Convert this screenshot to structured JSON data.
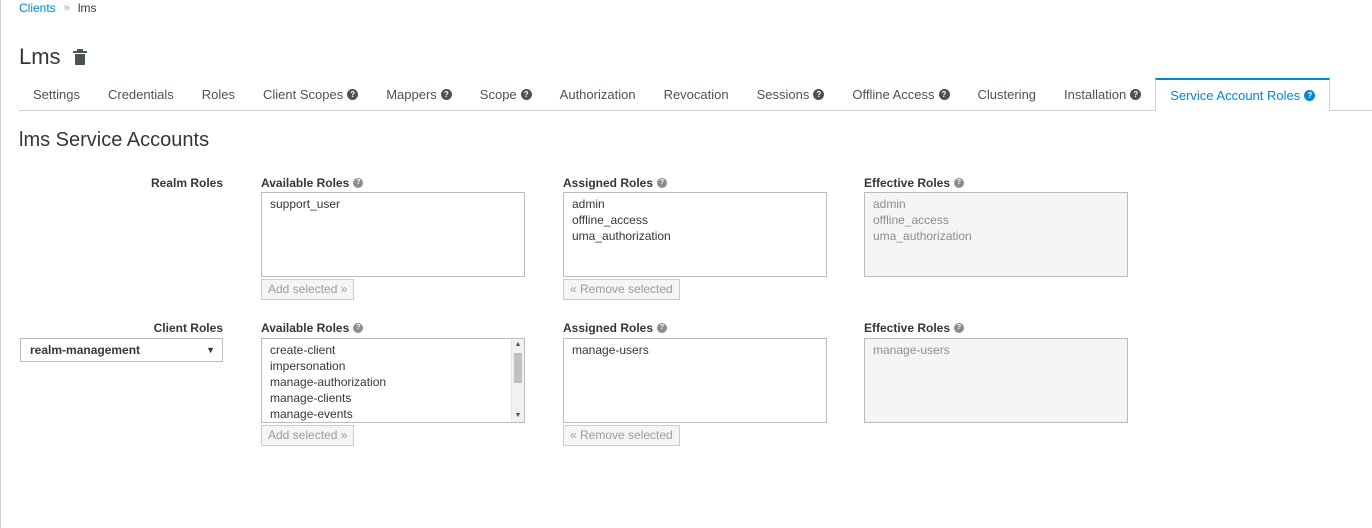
{
  "breadcrumb": {
    "parent": "Clients",
    "separator": "»",
    "current": "lms"
  },
  "page": {
    "title": "Lms"
  },
  "tabs": [
    {
      "label": "Settings",
      "help": false
    },
    {
      "label": "Credentials",
      "help": false
    },
    {
      "label": "Roles",
      "help": false
    },
    {
      "label": "Client Scopes",
      "help": true
    },
    {
      "label": "Mappers",
      "help": true
    },
    {
      "label": "Scope",
      "help": true
    },
    {
      "label": "Authorization",
      "help": false
    },
    {
      "label": "Revocation",
      "help": false
    },
    {
      "label": "Sessions",
      "help": true
    },
    {
      "label": "Offline Access",
      "help": true
    },
    {
      "label": "Clustering",
      "help": false
    },
    {
      "label": "Installation",
      "help": true
    },
    {
      "label": "Service Account Roles",
      "help": true,
      "active": true
    }
  ],
  "section": {
    "title": "lms Service Accounts"
  },
  "realm_roles": {
    "label": "Realm Roles",
    "available_label": "Available Roles",
    "assigned_label": "Assigned Roles",
    "effective_label": "Effective Roles",
    "available": [
      "support_user"
    ],
    "assigned": [
      "admin",
      "offline_access",
      "uma_authorization"
    ],
    "effective": [
      "admin",
      "offline_access",
      "uma_authorization"
    ],
    "add_label": "Add selected »",
    "remove_label": "« Remove selected"
  },
  "client_roles": {
    "label": "Client Roles",
    "client_select": "realm-management",
    "available_label": "Available Roles",
    "assigned_label": "Assigned Roles",
    "effective_label": "Effective Roles",
    "available": [
      "create-client",
      "impersonation",
      "manage-authorization",
      "manage-clients",
      "manage-events"
    ],
    "assigned": [
      "manage-users"
    ],
    "effective": [
      "manage-users"
    ],
    "add_label": "Add selected »",
    "remove_label": "« Remove selected"
  },
  "icons": {
    "trash": "trash-icon",
    "help": "question-circle-icon",
    "caret": "caret-down-icon"
  },
  "colors": {
    "link": "#0088ce",
    "text": "#363636",
    "border": "#d1d1d1"
  }
}
